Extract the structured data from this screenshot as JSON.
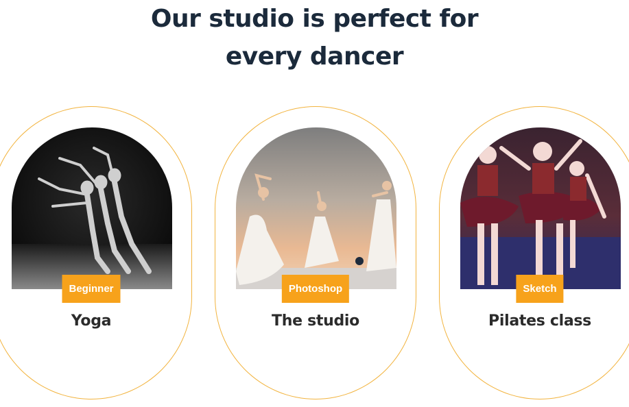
{
  "heading": {
    "line1": "Our studio is perfect for",
    "line2": "every dancer"
  },
  "cards": [
    {
      "badge": "Beginner",
      "title": "Yoga",
      "image_icon": "dance-photo-black-white"
    },
    {
      "badge": "Photoshop",
      "title": "The studio",
      "image_icon": "dance-photo-sunset-dresses"
    },
    {
      "badge": "Sketch",
      "title": "Pilates class",
      "image_icon": "dance-photo-ballet-girls"
    }
  ],
  "colors": {
    "accent": "#f7a21b",
    "card_border": "#f2b33d",
    "heading": "#1b2a3b",
    "title": "#2b2b2b"
  }
}
